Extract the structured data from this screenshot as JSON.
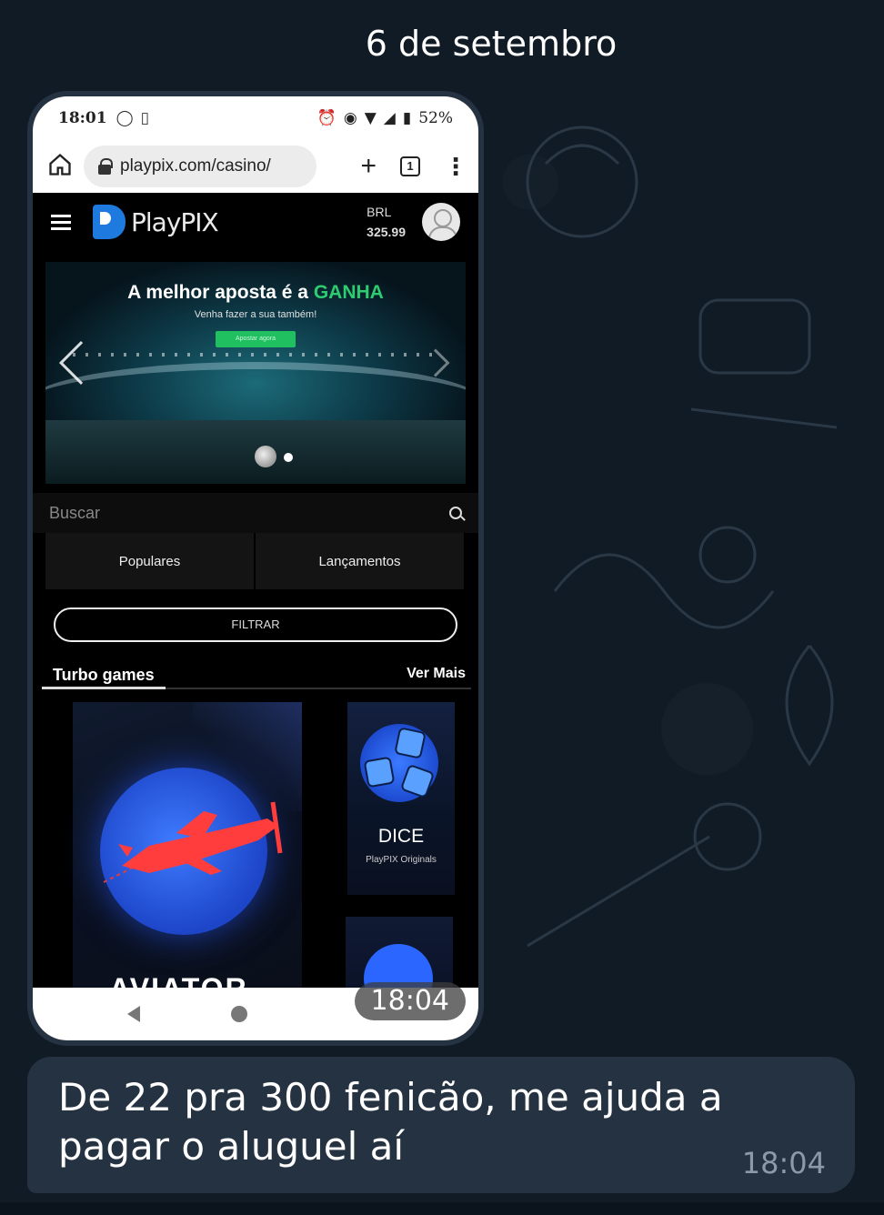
{
  "chat": {
    "date_label": "6 de setembro",
    "photo_time": "18:04",
    "message_text": "De 22 pra 300 fenicão, me ajuda a pagar o aluguel aí",
    "message_time": "18:04"
  },
  "phone": {
    "status_bar": {
      "time": "18:01",
      "battery": "52%"
    },
    "browser": {
      "url": "playpix.com/casino/",
      "tabs_count": "1"
    },
    "site": {
      "brand": "PlayPIX",
      "currency": "BRL",
      "balance": "325.99"
    },
    "banner": {
      "title_prefix": "A melhor aposta é a",
      "title_accent": "GANHA",
      "subtitle": "Venha fazer a sua também!",
      "cta": "Apostar agora"
    },
    "search": {
      "placeholder": "Buscar"
    },
    "category_tabs": [
      "Populares",
      "Lançamentos"
    ],
    "filter_label": "FILTRAR",
    "section": {
      "title": "Turbo games",
      "more": "Ver Mais"
    },
    "games": [
      {
        "name": "AVIATOR"
      },
      {
        "name": "DICE",
        "subtitle": "PlayPIX Originals"
      }
    ]
  },
  "colors": {
    "chat_background": "#101b26",
    "bubble": "#253241",
    "brand_blue": "#1f7ae0",
    "accent_green": "#2ecc71"
  }
}
